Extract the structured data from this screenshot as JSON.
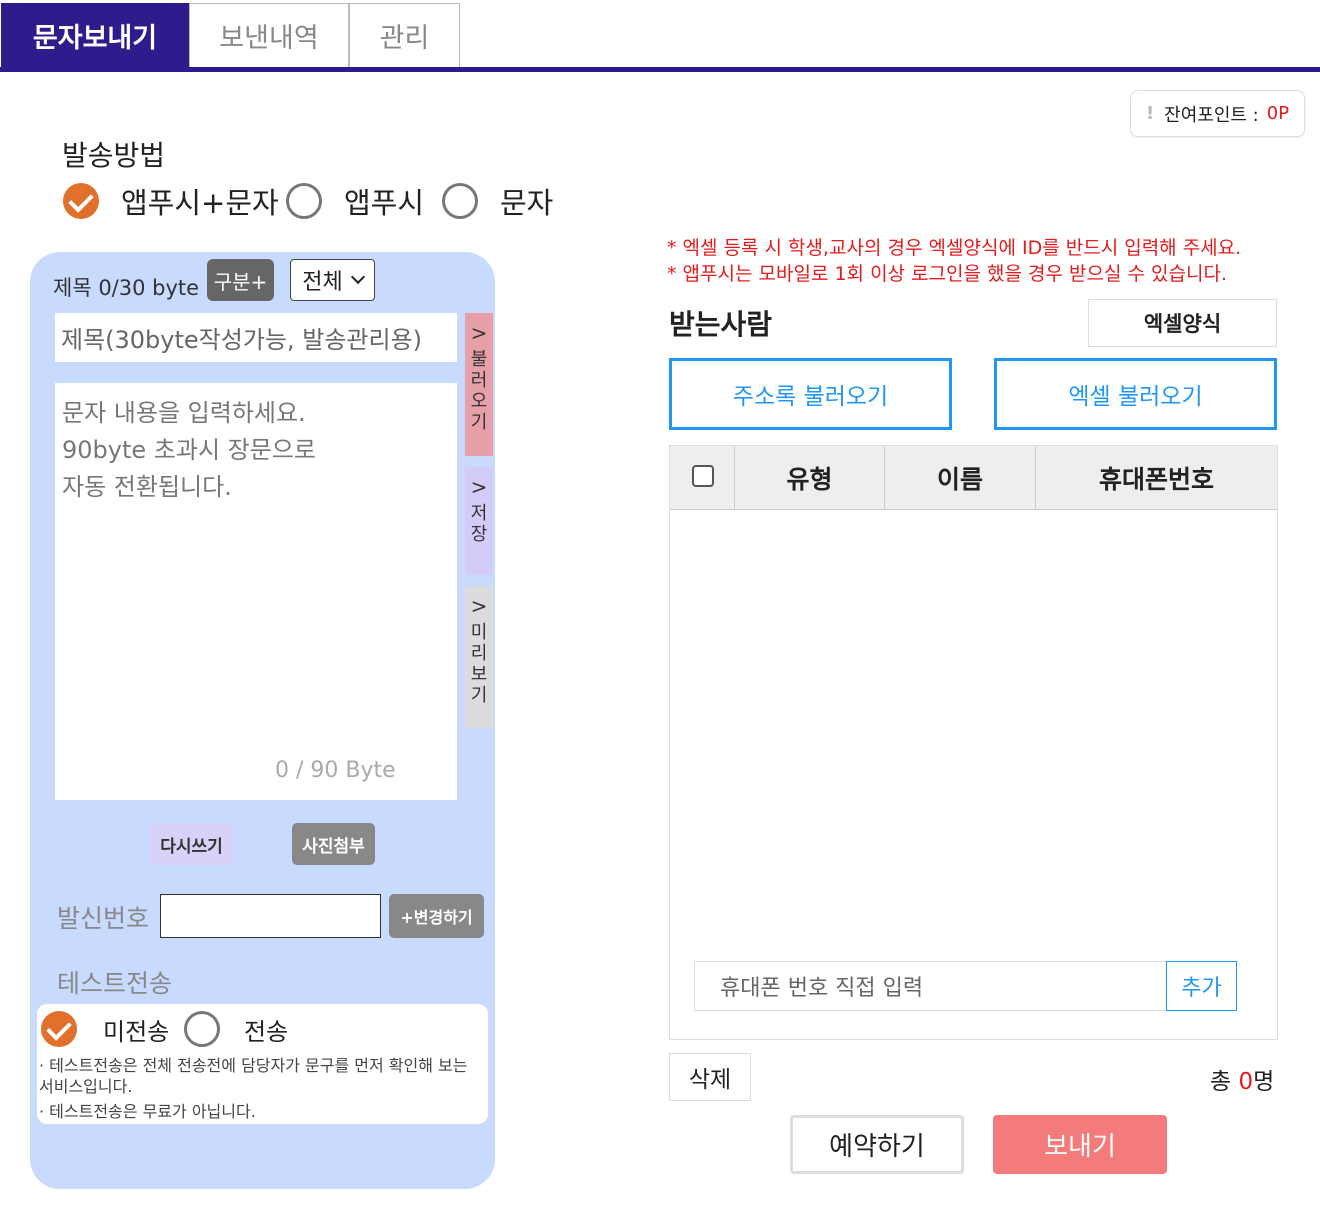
{
  "tabs": [
    {
      "label": "문자보내기",
      "active": true
    },
    {
      "label": "보낸내역",
      "active": false
    },
    {
      "label": "관리",
      "active": false
    }
  ],
  "points": {
    "label": "잔여포인트 :",
    "value": "0P",
    "icon": "exclamation-icon"
  },
  "send_method": {
    "title": "발송방법",
    "options": [
      {
        "label": "앱푸시+문자",
        "checked": true
      },
      {
        "label": "앱푸시",
        "checked": false
      },
      {
        "label": "문자",
        "checked": false
      }
    ]
  },
  "compose": {
    "subject_label": "제목 0/30 byte",
    "category_button": "구분+",
    "select_value": "전체",
    "subject_placeholder": "제목(30byte작성가능, 발송관리용)",
    "message_placeholder_lines": [
      "문자 내용을 입력하세요.",
      "90byte 초과시 장문으로",
      "자동 전환됩니다."
    ],
    "byte_counter": "0 / 90 Byte",
    "side_tabs": [
      {
        "label": "불러오기",
        "chars": [
          "불",
          "러",
          "오",
          "기"
        ],
        "color": "#e8a0a8"
      },
      {
        "label": "저장",
        "chars": [
          "저",
          "장"
        ],
        "color": "#d4ccf8"
      },
      {
        "label": "미리보기",
        "chars": [
          "미",
          "리",
          "보",
          "기"
        ],
        "color": "#dcdcdc"
      }
    ],
    "rewrite_button": "다시쓰기",
    "photo_button": "사진첨부",
    "sender_label": "발신번호",
    "sender_value": "",
    "change_button": "+변경하기",
    "test_label": "테스트전송",
    "test_options": [
      {
        "label": "미전송",
        "checked": true
      },
      {
        "label": "전송",
        "checked": false
      }
    ],
    "test_notes": [
      "· 테스트전송은 전체 전송전에 담당자가 문구를 먼저 확인해 보는 서비스입니다.",
      "· 테스트전송은 무료가 아닙니다."
    ]
  },
  "recipients": {
    "notices": [
      "* 엑셀 등록 시 학생,교사의 경우 엑셀양식에 ID를 반드시 입력해 주세요.",
      "* 앱푸시는 모바일로 1회 이상 로그인을 했을 경우 받으실 수 있습니다."
    ],
    "title": "받는사람",
    "excel_form_button": "엑셀양식",
    "address_book_button": "주소록 불러오기",
    "excel_load_button": "엑셀 불러오기",
    "columns": [
      "유형",
      "이름",
      "휴대폰번호"
    ],
    "rows": [],
    "phone_placeholder": "휴대폰 번호 직접 입력",
    "add_button": "추가",
    "delete_button": "삭제",
    "total_prefix": "총 ",
    "total_count": "0",
    "total_suffix": "명"
  },
  "actions": {
    "reserve": "예약하기",
    "send": "보내기"
  },
  "colors": {
    "brand": "#2d1d8c",
    "accent_orange": "#e0702b",
    "panel": "#c9daff",
    "blue": "#2196f3",
    "red": "#e41b1b",
    "send": "#f37b7b"
  }
}
